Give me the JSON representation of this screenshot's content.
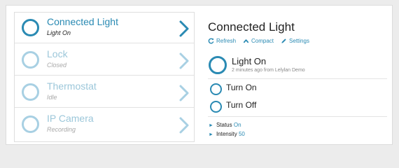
{
  "devices": [
    {
      "name": "Connected Light",
      "state": "Light On",
      "active": true
    },
    {
      "name": "Lock",
      "state": "Closed",
      "active": false
    },
    {
      "name": "Thermostat",
      "state": "Idle",
      "active": false
    },
    {
      "name": "IP Camera",
      "state": "Recording",
      "active": false
    }
  ],
  "detail": {
    "title": "Connected Light",
    "actions": {
      "refresh": "Refresh",
      "compact": "Compact",
      "settings": "Settings"
    },
    "status": {
      "label": "Light On",
      "meta": "2 minutes ago from Lelylan Demo"
    },
    "commands": [
      {
        "label": "Turn On"
      },
      {
        "label": "Turn Off"
      }
    ],
    "properties": [
      {
        "name": "Status",
        "value": "On"
      },
      {
        "name": "Intensity",
        "value": "50"
      }
    ]
  },
  "colors": {
    "accent": "#2a8ab3",
    "accent_faded": "#a8d0e3"
  }
}
